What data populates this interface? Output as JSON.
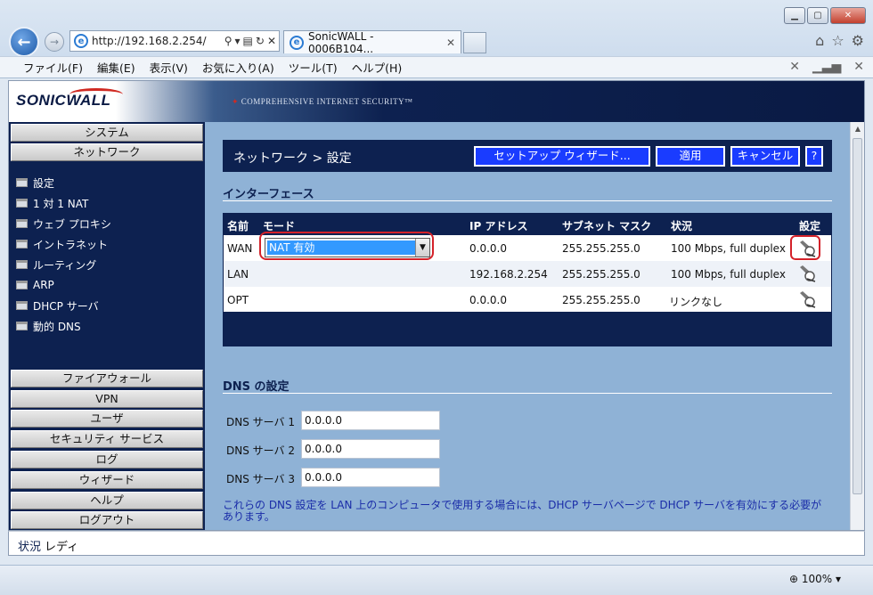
{
  "browser": {
    "address": "http://192.168.2.254/",
    "tab_title": "SonicWALL - 0006B104...",
    "menu": [
      "ファイル(F)",
      "編集(E)",
      "表示(V)",
      "お気に入り(A)",
      "ツール(T)",
      "ヘルプ(H)"
    ],
    "zoom": "100%"
  },
  "banner": {
    "logo": "SONICWALL",
    "tagline": "COMPREHENSIVE INTERNET SECURITY™"
  },
  "sidebar": {
    "top_buttons": [
      "システム",
      "ネットワーク"
    ],
    "items": [
      "設定",
      "1 対 1 NAT",
      "ウェブ プロキシ",
      "イントラネット",
      "ルーティング",
      "ARP",
      "DHCP サーバ",
      "動的 DNS"
    ],
    "bottom_buttons": [
      "ファイアウォール",
      "VPN",
      "ユーザ",
      "セキュリティ サービス",
      "ログ",
      "ウィザード",
      "ヘルプ",
      "ログアウト"
    ]
  },
  "header": {
    "title": "ネットワーク > 設定",
    "wizard_button": "セットアップ ウィザード...",
    "apply_button": "適用",
    "cancel_button": "キャンセル",
    "help_button": "?"
  },
  "interfaces": {
    "heading": "インターフェース",
    "columns": [
      "名前",
      "モード",
      "IP アドレス",
      "サブネット マスク",
      "状況",
      "設定"
    ],
    "rows": [
      {
        "name": "WAN",
        "mode": "NAT 有効",
        "ip": "0.0.0.0",
        "mask": "255.255.255.0",
        "status": "100 Mbps, full duplex"
      },
      {
        "name": "LAN",
        "mode": "",
        "ip": "192.168.2.254",
        "mask": "255.255.255.0",
        "status": "100 Mbps, full duplex"
      },
      {
        "name": "OPT",
        "mode": "",
        "ip": "0.0.0.0",
        "mask": "255.255.255.0",
        "status": "リンクなし"
      }
    ]
  },
  "dns": {
    "heading": "DNS の設定",
    "servers": [
      {
        "label": "DNS サーバ 1",
        "value": "0.0.0.0"
      },
      {
        "label": "DNS サーバ 2",
        "value": "0.0.0.0"
      },
      {
        "label": "DNS サーバ 3",
        "value": "0.0.0.0"
      }
    ],
    "note": "これらの DNS 設定を LAN 上のコンピュータで使用する場合には、DHCP サーバページで DHCP サーバを有効にする必要があります。"
  },
  "status": {
    "label": "状況",
    "value": "レディ"
  },
  "colors": {
    "navy": "#0d2150",
    "button_blue": "#1a3cff",
    "panel": "#8fb2d6",
    "highlight_ring": "#d4222a"
  }
}
